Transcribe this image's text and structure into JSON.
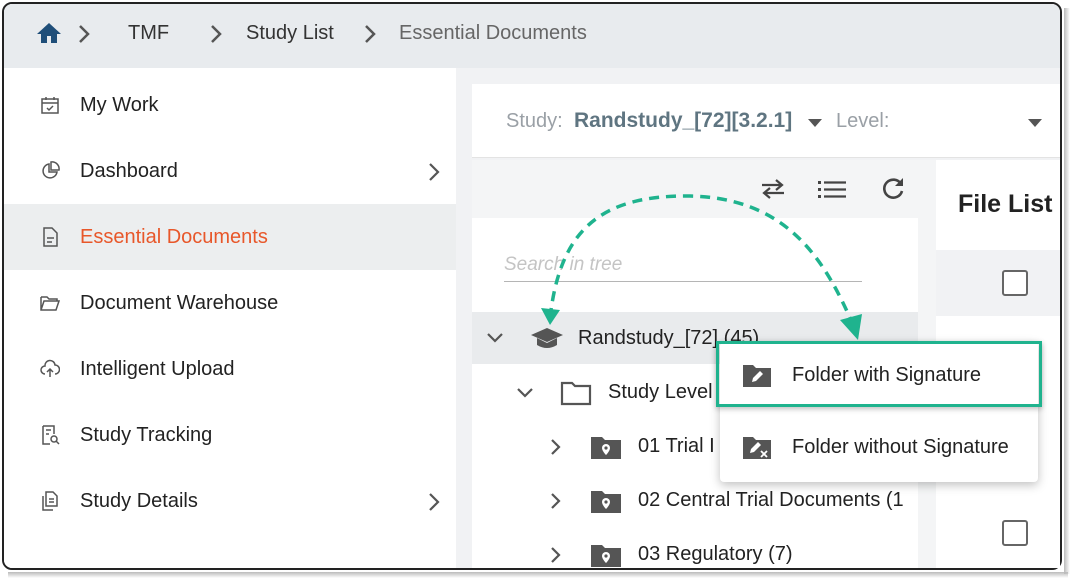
{
  "breadcrumb": {
    "home_icon": "home-icon",
    "items": [
      "TMF",
      "Study List",
      "Essential Documents"
    ]
  },
  "sidebar": {
    "items": [
      {
        "label": "My Work",
        "icon": "calendar-check-icon"
      },
      {
        "label": "Dashboard",
        "icon": "pie-chart-icon"
      },
      {
        "label": "Essential Documents",
        "icon": "document-icon"
      },
      {
        "label": "Document Warehouse",
        "icon": "folder-open-icon"
      },
      {
        "label": "Intelligent Upload",
        "icon": "cloud-upload-icon"
      },
      {
        "label": "Study Tracking",
        "icon": "document-search-icon"
      },
      {
        "label": "Study Details",
        "icon": "documents-icon"
      }
    ],
    "selected": "Essential Documents",
    "accent_color": "#e8572a"
  },
  "study_bar": {
    "study_label": "Study:",
    "study_value": "Randstudy_[72][3.2.1]",
    "level_label": "Level:"
  },
  "tree": {
    "search_placeholder": "Search in tree",
    "nodes": [
      {
        "label": "Randstudy_[72] (45)"
      },
      {
        "label": "Study Level"
      },
      {
        "label": "01  Trial I"
      },
      {
        "label": "02  Central Trial Documents (1"
      },
      {
        "label": "03  Regulatory (7)"
      }
    ]
  },
  "file_list": {
    "title": "File List"
  },
  "context_menu": {
    "items": [
      {
        "label": "Folder with Signature",
        "icon": "folder-edit-icon"
      },
      {
        "label": "Folder without Signature",
        "icon": "folder-edit-off-icon"
      }
    ],
    "highlight_color": "#1fb38e"
  }
}
